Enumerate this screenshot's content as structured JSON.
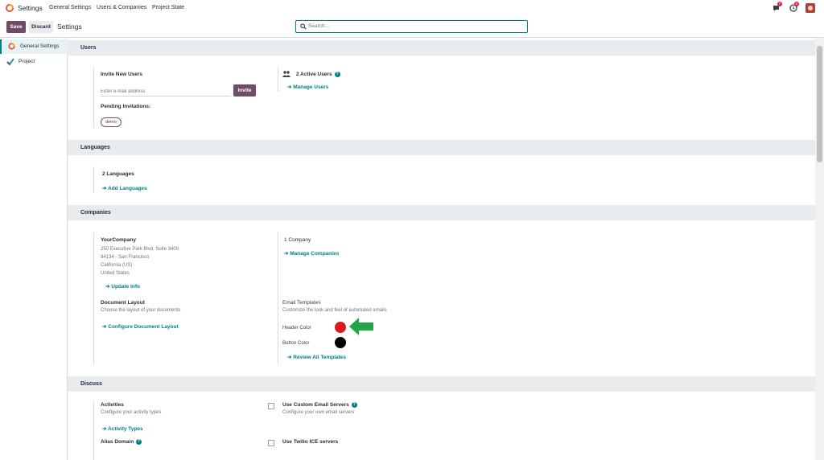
{
  "navbar": {
    "app_name": "Settings",
    "menu": [
      "General Settings",
      "Users & Companies",
      "Project State"
    ],
    "msg_count": "7",
    "activity_count": "3"
  },
  "control_panel": {
    "save_label": "Save",
    "discard_label": "Discard",
    "title": "Settings",
    "search_placeholder": "Search..."
  },
  "sidebar": {
    "items": [
      {
        "label": "General Settings",
        "icon": "odoo-logo-icon"
      },
      {
        "label": "Project",
        "icon": "project-check-icon"
      }
    ]
  },
  "sections": {
    "users": {
      "title": "Users",
      "invite_heading": "Invite New Users",
      "email_placeholder": "Enter e-mail address",
      "invite_button": "Invite",
      "pending_label": "Pending Invitations:",
      "pending_tag": "demo",
      "active_users": "2 Active Users",
      "manage_users": "Manage Users"
    },
    "languages": {
      "title": "Languages",
      "count": "2 Languages",
      "add_languages": "Add Languages"
    },
    "companies": {
      "title": "Companies",
      "company_name": "YourCompany",
      "address_lines": [
        "250 Executive Park Blvd, Suite 3400",
        "94134 - San Francisco",
        "California (US)",
        "United States"
      ],
      "update_info": "Update Info",
      "company_count": "1 Company",
      "manage_companies": "Manage Companies",
      "document_layout_title": "Document Layout",
      "document_layout_desc": "Choose the layout of your documents",
      "configure_layout": "Configure Document Layout",
      "email_templates_title": "Email Templates",
      "email_templates_desc": "Customize the look and feel of automated emails",
      "header_color_label": "Header Color",
      "header_color": "#d81b1b",
      "button_color_label": "Button Color",
      "button_color": "#000000",
      "review_templates": "Review All Templates"
    },
    "discuss": {
      "title": "Discuss",
      "activities_title": "Activities",
      "activities_desc": "Configure your activity types",
      "activity_types": "Activity Types",
      "custom_email_title": "Use Custom Email Servers",
      "custom_email_desc": "Configure your own email servers",
      "alias_domain": "Alias Domain",
      "twilio_title": "Use Twilio ICE servers"
    }
  },
  "colors": {
    "brand": "#714b67",
    "link": "#017e84",
    "arrow": "#22a447"
  }
}
